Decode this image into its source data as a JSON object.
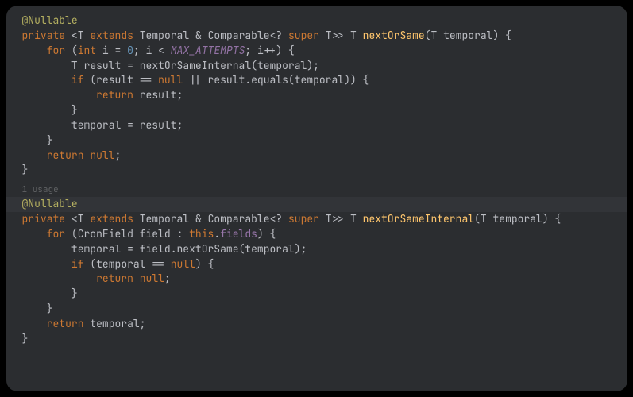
{
  "method1": {
    "annotation": "@Nullable",
    "access": "private",
    "generic_prefix": "<",
    "typeparam": "T",
    "extends": " extends ",
    "temporal": "Temporal",
    "amp": " & ",
    "comparable": "Comparable",
    "wildcard_open": "<? ",
    "super": "super ",
    "wildcard_close": ">> ",
    "return_type": "T",
    "name": "nextOrSame",
    "param_open": "(",
    "param_type": "T",
    "param_name": " temporal",
    "param_close": ") {",
    "for_kw": "for",
    "for_open": " (",
    "int_kw": "int",
    "i_decl": " i = ",
    "zero": "0",
    "semi1": "; i < ",
    "max_attempts": "MAX_ATTEMPTS",
    "semi2": "; i++) {",
    "result_type": "T",
    "result_decl": " result = nextOrSameInternal(temporal);",
    "if_kw": "if",
    "if_cond": " (result == ",
    "null1": "null",
    "or": " || result.equals(temporal)) {",
    "return_kw": "return",
    "return_result": " result;",
    "brace_close": "}",
    "assign": "temporal = result;",
    "return_null_kw": "return",
    "return_null": " null",
    "semi": ";"
  },
  "usage": "1 usage",
  "method2": {
    "annotation": "@Nullable",
    "access": "private",
    "generic_prefix": "<",
    "typeparam": "T",
    "extends": " extends ",
    "temporal": "Temporal",
    "amp": " & ",
    "comparable": "Comparable",
    "wildcard_open": "<? ",
    "super": "super ",
    "wildcard_close": ">> ",
    "return_type": "T",
    "name": "nextOrSameInternal",
    "param_open": "(",
    "param_type": "T",
    "param_name": " temporal",
    "param_close": ") {",
    "for_kw": "for",
    "for_open": " (CronField field : ",
    "this_kw": "this",
    "dot_fields": ".",
    "fields": "fields",
    "for_close": ") {",
    "assign": "temporal = field.nextOrSame(temporal);",
    "if_kw": "if",
    "if_cond": " (temporal == ",
    "null1": "null",
    "if_close": ") {",
    "return_kw": "return",
    "return_null": " null",
    "semi": ";",
    "brace_close": "}",
    "return_temporal_kw": "return",
    "return_temporal": " temporal;"
  }
}
